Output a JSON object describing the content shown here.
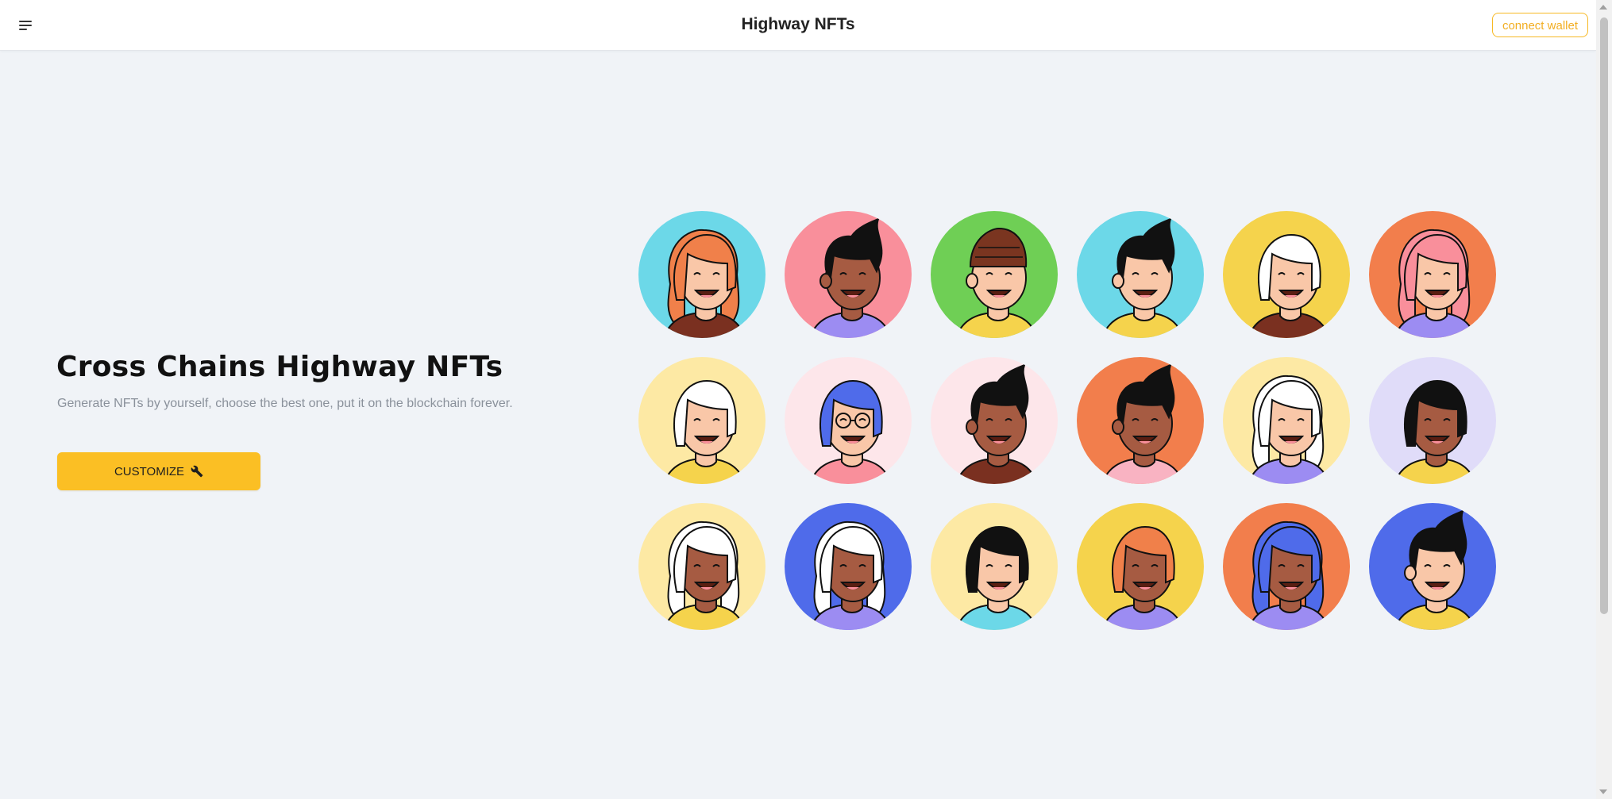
{
  "header": {
    "title": "Highway NFTs",
    "connect_label": "connect wallet"
  },
  "hero": {
    "title": "Cross Chains Highway NFTs",
    "subtitle": "Generate NFTs by yourself, choose the best one, put it on the blockchain forever.",
    "cta_label": "CUSTOMIZE",
    "cta_icon": "wrench-icon"
  },
  "colors": {
    "accent": "#fbbf24",
    "background": "#f0f3f7"
  },
  "avatars": [
    {
      "bg": "#6cd8e8",
      "skin": "#f9c7a8",
      "hair": "#f0804a",
      "hair_style": "long",
      "shirt": "#7a3020",
      "glasses": false
    },
    {
      "bg": "#f98f9b",
      "skin": "#a65b42",
      "hair": "#111111",
      "hair_style": "quiff",
      "shirt": "#9c8cf2",
      "glasses": false
    },
    {
      "bg": "#6fcf55",
      "skin": "#f9c7a8",
      "hair": "#7a3520",
      "hair_style": "beanie",
      "shirt": "#f5d34c",
      "glasses": false
    },
    {
      "bg": "#6cd8e8",
      "skin": "#f9c7a8",
      "hair": "#111111",
      "hair_style": "quiff",
      "shirt": "#f5d34c",
      "glasses": false
    },
    {
      "bg": "#f5d34c",
      "skin": "#f9c7a8",
      "hair": "#ffffff",
      "hair_style": "bob",
      "shirt": "#7a3020",
      "glasses": false
    },
    {
      "bg": "#f27e4c",
      "skin": "#f9c7a8",
      "hair": "#f98f9b",
      "hair_style": "long",
      "shirt": "#9c8cf2",
      "glasses": false
    },
    {
      "bg": "#fde9a4",
      "skin": "#f9c7a8",
      "hair": "#ffffff",
      "hair_style": "bob",
      "shirt": "#f5d34c",
      "glasses": false
    },
    {
      "bg": "#fde6ea",
      "skin": "#f9c7a8",
      "hair": "#4f6bea",
      "hair_style": "bob",
      "shirt": "#f98f9b",
      "glasses": true
    },
    {
      "bg": "#fde6ea",
      "skin": "#a65b42",
      "hair": "#111111",
      "hair_style": "quiff",
      "shirt": "#7a3020",
      "glasses": false
    },
    {
      "bg": "#f27e4c",
      "skin": "#a65b42",
      "hair": "#111111",
      "hair_style": "quiff",
      "shirt": "#f9b3c2",
      "glasses": false
    },
    {
      "bg": "#fde9a4",
      "skin": "#f9c7a8",
      "hair": "#ffffff",
      "hair_style": "long",
      "shirt": "#9c8cf2",
      "glasses": false
    },
    {
      "bg": "#e0dcf9",
      "skin": "#a65b42",
      "hair": "#111111",
      "hair_style": "bob",
      "shirt": "#f5d34c",
      "glasses": false
    },
    {
      "bg": "#fde9a4",
      "skin": "#a65b42",
      "hair": "#ffffff",
      "hair_style": "long",
      "shirt": "#f5d34c",
      "glasses": false
    },
    {
      "bg": "#4f6bea",
      "skin": "#a65b42",
      "hair": "#ffffff",
      "hair_style": "long",
      "shirt": "#9c8cf2",
      "glasses": false
    },
    {
      "bg": "#fde9a4",
      "skin": "#f9c7a8",
      "hair": "#111111",
      "hair_style": "bob",
      "shirt": "#6cd8e8",
      "glasses": false
    },
    {
      "bg": "#f5d34c",
      "skin": "#a65b42",
      "hair": "#f0804a",
      "hair_style": "bob",
      "shirt": "#9c8cf2",
      "glasses": false
    },
    {
      "bg": "#f27e4c",
      "skin": "#a65b42",
      "hair": "#4f6bea",
      "hair_style": "long",
      "shirt": "#9c8cf2",
      "glasses": false
    },
    {
      "bg": "#4f6bea",
      "skin": "#f9c7a8",
      "hair": "#111111",
      "hair_style": "quiff",
      "shirt": "#f5d34c",
      "glasses": false
    }
  ]
}
